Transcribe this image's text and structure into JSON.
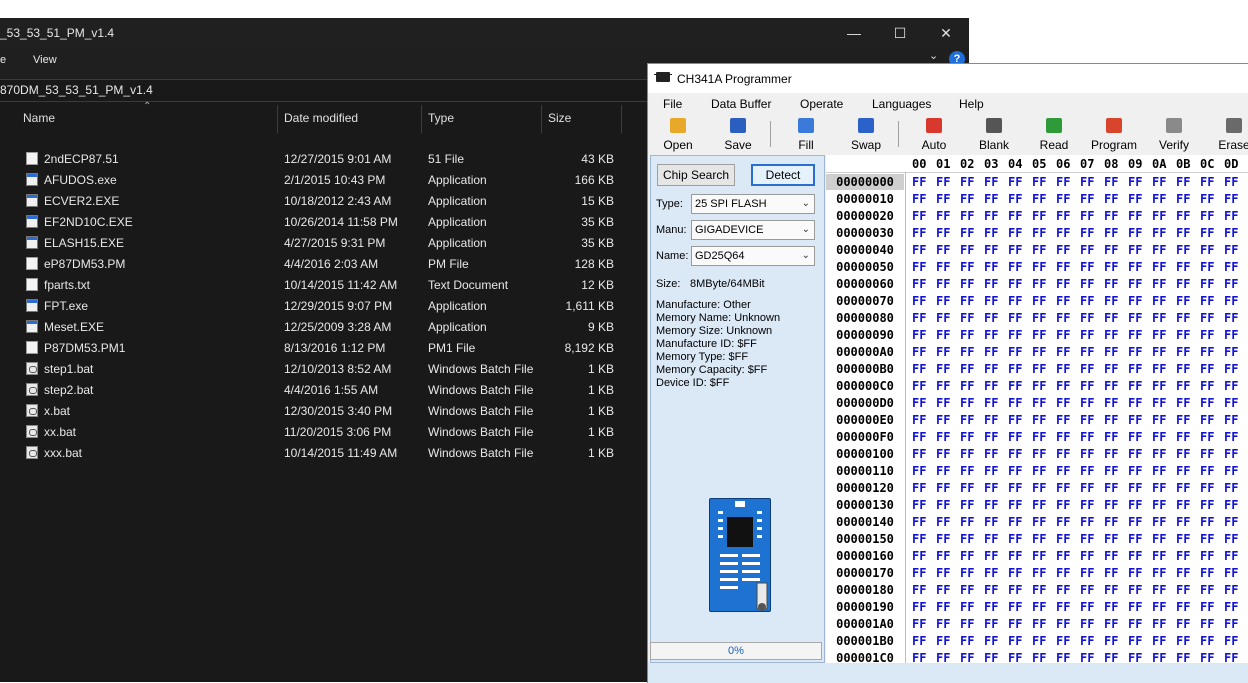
{
  "explorer": {
    "title": "_53_53_51_PM_v1.4",
    "menu": [
      "e",
      "View"
    ],
    "address": "870DM_53_53_51_PM_v1.4",
    "columns": [
      "Name",
      "Date modified",
      "Type",
      "Size"
    ],
    "files": [
      {
        "name": "2ndECP87.51",
        "date": "12/27/2015 9:01 AM",
        "type": "51 File",
        "size": "43 KB",
        "icon": "doc"
      },
      {
        "name": "AFUDOS.exe",
        "date": "2/1/2015 10:43 PM",
        "type": "Application",
        "size": "166 KB",
        "icon": "app"
      },
      {
        "name": "ECVER2.EXE",
        "date": "10/18/2012 2:43 AM",
        "type": "Application",
        "size": "15 KB",
        "icon": "app"
      },
      {
        "name": "EF2ND10C.EXE",
        "date": "10/26/2014 11:58 PM",
        "type": "Application",
        "size": "35 KB",
        "icon": "app"
      },
      {
        "name": "ELASH15.EXE",
        "date": "4/27/2015 9:31 PM",
        "type": "Application",
        "size": "35 KB",
        "icon": "app"
      },
      {
        "name": "eP87DM53.PM",
        "date": "4/4/2016 2:03 AM",
        "type": "PM File",
        "size": "128 KB",
        "icon": "doc"
      },
      {
        "name": "fparts.txt",
        "date": "10/14/2015 11:42 AM",
        "type": "Text Document",
        "size": "12 KB",
        "icon": "doc"
      },
      {
        "name": "FPT.exe",
        "date": "12/29/2015 9:07 PM",
        "type": "Application",
        "size": "1,611 KB",
        "icon": "app"
      },
      {
        "name": "Meset.EXE",
        "date": "12/25/2009 3:28 AM",
        "type": "Application",
        "size": "9 KB",
        "icon": "app"
      },
      {
        "name": "P87DM53.PM1",
        "date": "8/13/2016 1:12 PM",
        "type": "PM1 File",
        "size": "8,192 KB",
        "icon": "doc"
      },
      {
        "name": "step1.bat",
        "date": "12/10/2013 8:52 AM",
        "type": "Windows Batch File",
        "size": "1 KB",
        "icon": "bat"
      },
      {
        "name": "step2.bat",
        "date": "4/4/2016 1:55 AM",
        "type": "Windows Batch File",
        "size": "1 KB",
        "icon": "bat"
      },
      {
        "name": "x.bat",
        "date": "12/30/2015 3:40 PM",
        "type": "Windows Batch File",
        "size": "1 KB",
        "icon": "bat"
      },
      {
        "name": "xx.bat",
        "date": "11/20/2015 3:06 PM",
        "type": "Windows Batch File",
        "size": "1 KB",
        "icon": "bat"
      },
      {
        "name": "xxx.bat",
        "date": "10/14/2015 11:49 AM",
        "type": "Windows Batch File",
        "size": "1 KB",
        "icon": "bat"
      }
    ]
  },
  "programmer": {
    "title": "CH341A Programmer",
    "menu": [
      "File",
      "Data Buffer",
      "Operate",
      "Languages",
      "Help"
    ],
    "toolbar": [
      {
        "label": "Open",
        "icon": "folder-open-icon",
        "color": "#e8a92b"
      },
      {
        "label": "Save",
        "icon": "floppy-disk-icon",
        "color": "#2a5fc0"
      },
      {
        "label": "Fill",
        "icon": "fill-icon",
        "color": "#3b7ad8"
      },
      {
        "label": "Swap",
        "icon": "swap-arrows-icon",
        "color": "#2a62c9"
      },
      {
        "label": "Auto",
        "icon": "auto-icon",
        "color": "#d9382f"
      },
      {
        "label": "Blank",
        "icon": "blank-check-icon",
        "color": "#555555"
      },
      {
        "label": "Read",
        "icon": "read-chip-icon",
        "color": "#2f9a3a"
      },
      {
        "label": "Program",
        "icon": "program-chip-icon",
        "color": "#d8452c"
      },
      {
        "label": "Verify",
        "icon": "verify-icon",
        "color": "#8a8a8a"
      },
      {
        "label": "Erase",
        "icon": "erase-icon",
        "color": "#6a6a6a"
      }
    ],
    "chip_search_label": "Chip Search",
    "detect_label": "Detect",
    "type_label": "Type:",
    "type_value": "25 SPI FLASH",
    "manu_label": "Manu:",
    "manu_value": "GIGADEVICE",
    "name_label": "Name:",
    "name_value": "GD25Q64",
    "size_label": "Size:",
    "size_value": "8MByte/64MBit",
    "info_lines": [
      "Manufacture: Other",
      "Memory Name: Unknown",
      "Memory Size: Unknown",
      "Manufacture ID: $FF",
      "Memory Type: $FF",
      "Memory Capacity: $FF",
      "Device ID: $FF"
    ],
    "progress": "0%",
    "hex_columns": [
      "00",
      "01",
      "02",
      "03",
      "04",
      "05",
      "06",
      "07",
      "08",
      "09",
      "0A",
      "0B",
      "0C",
      "0D"
    ],
    "hex_addresses": [
      "00000000",
      "00000010",
      "00000020",
      "00000030",
      "00000040",
      "00000050",
      "00000060",
      "00000070",
      "00000080",
      "00000090",
      "000000A0",
      "000000B0",
      "000000C0",
      "000000D0",
      "000000E0",
      "000000F0",
      "00000100",
      "00000110",
      "00000120",
      "00000130",
      "00000140",
      "00000150",
      "00000160",
      "00000170",
      "00000180",
      "00000190",
      "000001A0",
      "000001B0",
      "000001C0"
    ],
    "hex_byte": "FF"
  }
}
